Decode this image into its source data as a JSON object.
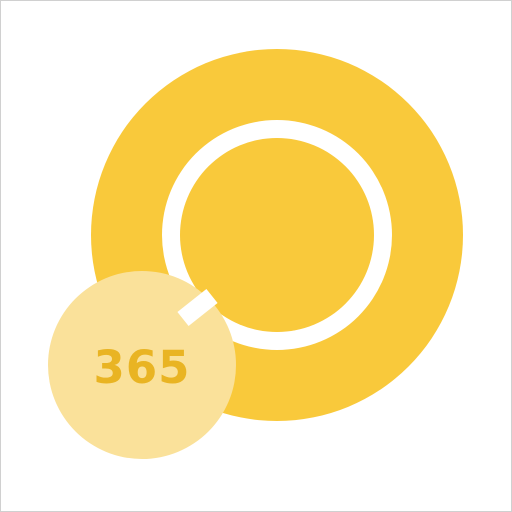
{
  "app_icon": {
    "badge": {
      "text": "365"
    },
    "colors": {
      "background": "#ffffff",
      "border": "#d0d0d0",
      "primary_yellow": "#f9c93b",
      "badge_fill": "#fae19a",
      "badge_text": "#e9b423",
      "ring_gap": "#ffffff"
    }
  }
}
